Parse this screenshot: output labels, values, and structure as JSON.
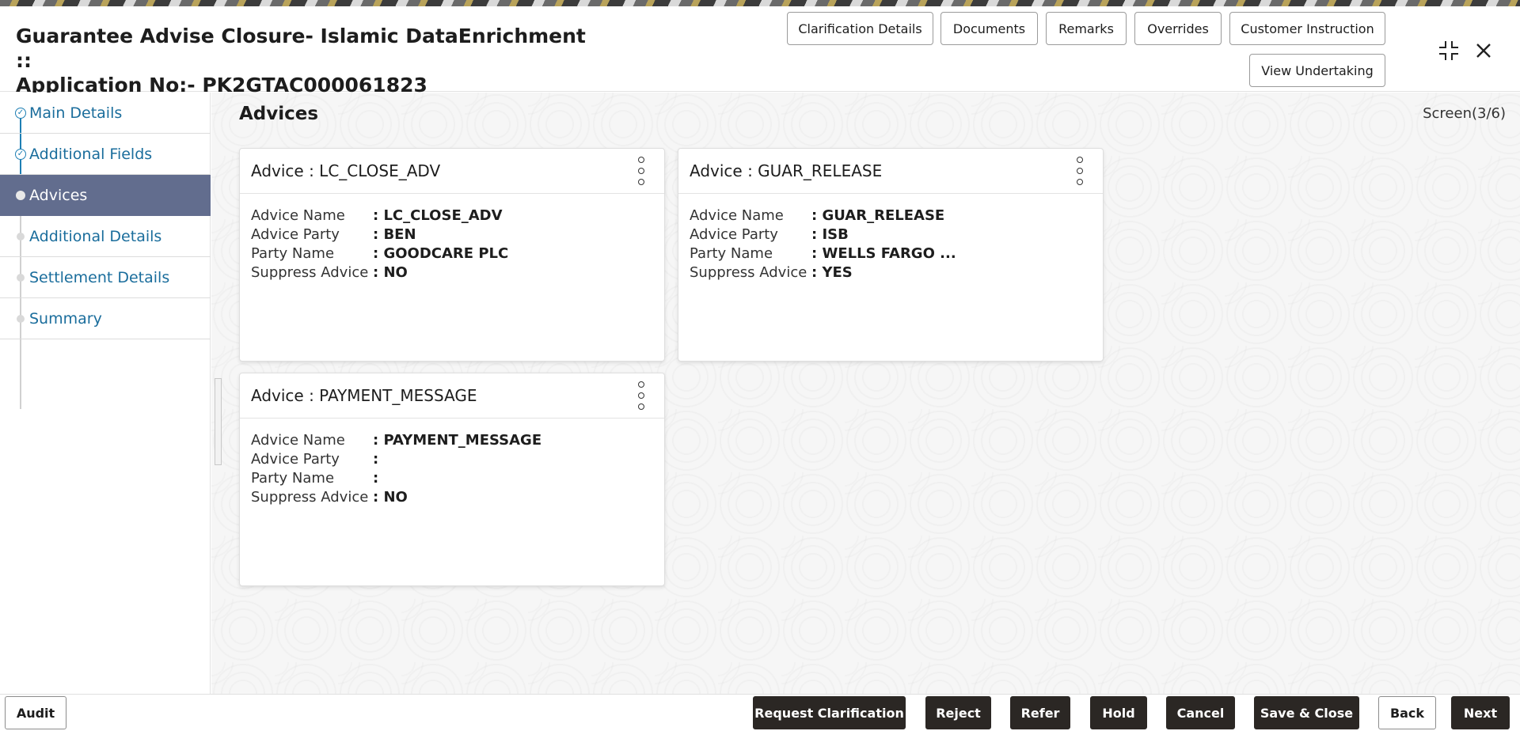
{
  "header": {
    "title_line1": "Guarantee Advise Closure- Islamic DataEnrichment ::",
    "title_line2": "Application No:-  PK2GTAC000061823",
    "buttons": {
      "clarification_details": "Clarification Details",
      "documents": "Documents",
      "remarks": "Remarks",
      "overrides": "Overrides",
      "customer_instruction": "Customer Instruction",
      "view_undertaking": "View Undertaking"
    },
    "icons": {
      "collapse": "collapse-icon",
      "close": "close-icon"
    }
  },
  "sidebar": {
    "items": [
      {
        "label": "Main Details",
        "state": "done"
      },
      {
        "label": "Additional Fields",
        "state": "done"
      },
      {
        "label": "Advices",
        "state": "active"
      },
      {
        "label": "Additional Details",
        "state": "pending"
      },
      {
        "label": "Settlement Details",
        "state": "pending"
      },
      {
        "label": "Summary",
        "state": "pending"
      }
    ]
  },
  "main": {
    "section_title": "Advices",
    "screen_indicator": "Screen(3/6)",
    "field_labels": {
      "advice_name": "Advice Name",
      "advice_party": "Advice Party",
      "party_name": "Party Name",
      "suppress_advice": "Suppress Advice"
    },
    "cards": [
      {
        "title": "Advice : LC_CLOSE_ADV",
        "advice_name": ": LC_CLOSE_ADV",
        "advice_party": ": BEN",
        "party_name": ": GOODCARE PLC",
        "suppress_advice": ": NO"
      },
      {
        "title": "Advice : GUAR_RELEASE",
        "advice_name": ": GUAR_RELEASE",
        "advice_party": ": ISB",
        "party_name": ": WELLS FARGO ...",
        "suppress_advice": ": YES"
      },
      {
        "title": "Advice : PAYMENT_MESSAGE",
        "advice_name": ": PAYMENT_MESSAGE",
        "advice_party": ":",
        "party_name": ":",
        "suppress_advice": ": NO"
      }
    ]
  },
  "footer": {
    "audit": "Audit",
    "request_clarification": "Request Clarification",
    "reject": "Reject",
    "refer": "Refer",
    "hold": "Hold",
    "cancel": "Cancel",
    "save_close": "Save & Close",
    "back": "Back",
    "next": "Next"
  }
}
